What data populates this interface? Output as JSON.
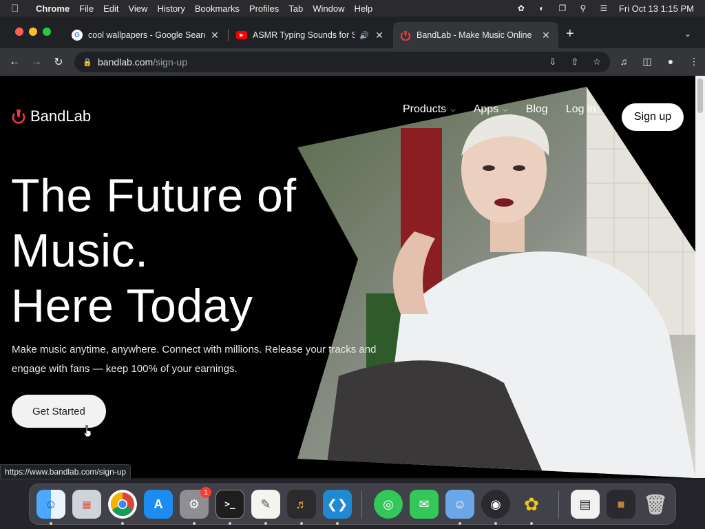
{
  "menubar": {
    "app": "Chrome",
    "items": [
      "File",
      "Edit",
      "View",
      "History",
      "Bookmarks",
      "Profiles",
      "Tab",
      "Window",
      "Help"
    ],
    "clock": "Fri Oct 13  1:15 PM"
  },
  "tabs": [
    {
      "title": "cool wallpapers - Google Search",
      "favicon": "google-icon"
    },
    {
      "title": "ASMR Typing Sounds for Studying",
      "favicon": "youtube-icon"
    },
    {
      "title": "BandLab - Make Music Online",
      "favicon": "bandlab-icon"
    }
  ],
  "omnibox": {
    "host": "bandlab.com",
    "path": "/sign-up"
  },
  "site": {
    "brand": "BandLab",
    "nav": {
      "products": "Products",
      "apps": "Apps",
      "blog": "Blog",
      "login": "Log in",
      "signup": "Sign up"
    },
    "headline": {
      "line1": "The Future of",
      "line2": "Music.",
      "line3": "Here Today"
    },
    "subcopy": "Make music anytime, anywhere. Connect with millions. Release your tracks and engage with fans — keep 100% of your earnings.",
    "cta": "Get Started",
    "accent": "#f2383d"
  },
  "status_url": "https://www.bandlab.com/sign-up",
  "dock": {
    "items": [
      "Finder",
      "Launchpad",
      "Google Chrome",
      "App Store",
      "System Settings",
      "Terminal",
      "TextEdit",
      "GarageBand",
      "Visual Studio Code",
      "Find My",
      "Messages",
      "Migration Assistant",
      "OBS",
      "Cyberduck",
      "Preview",
      "Screenshot",
      "Trash"
    ],
    "settings_badge": "1"
  }
}
